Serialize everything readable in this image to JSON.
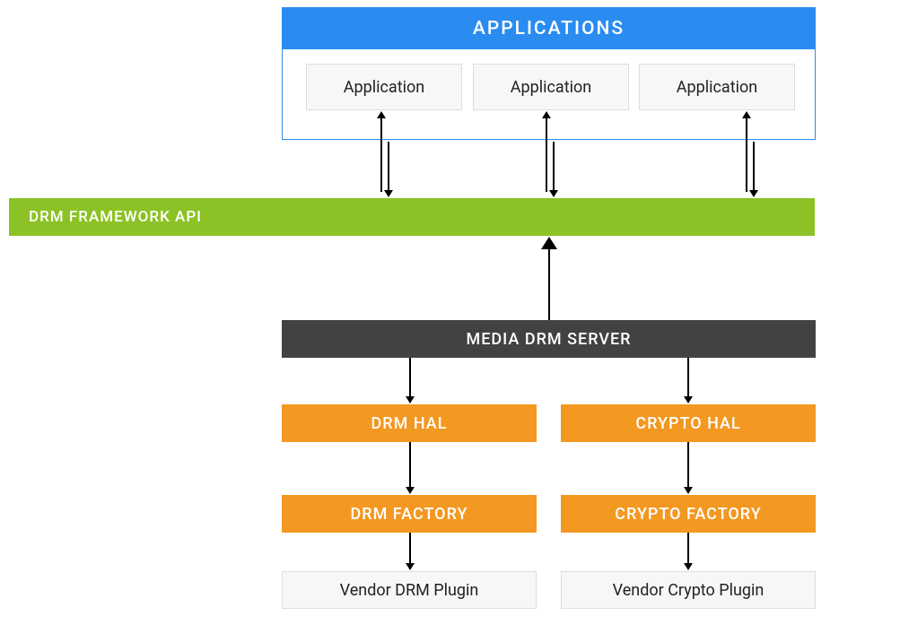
{
  "applications": {
    "header": "APPLICATIONS",
    "items": [
      "Application",
      "Application",
      "Application"
    ]
  },
  "drm_api": {
    "label": "DRM FRAMEWORK API"
  },
  "media_server": {
    "label": "MEDIA DRM SERVER"
  },
  "hals": {
    "drm": "DRM HAL",
    "crypto": "CRYPTO HAL"
  },
  "factories": {
    "drm": "DRM FACTORY",
    "crypto": "CRYPTO FACTORY"
  },
  "vendors": {
    "drm": "Vendor DRM Plugin",
    "crypto": "Vendor Crypto Plugin"
  }
}
